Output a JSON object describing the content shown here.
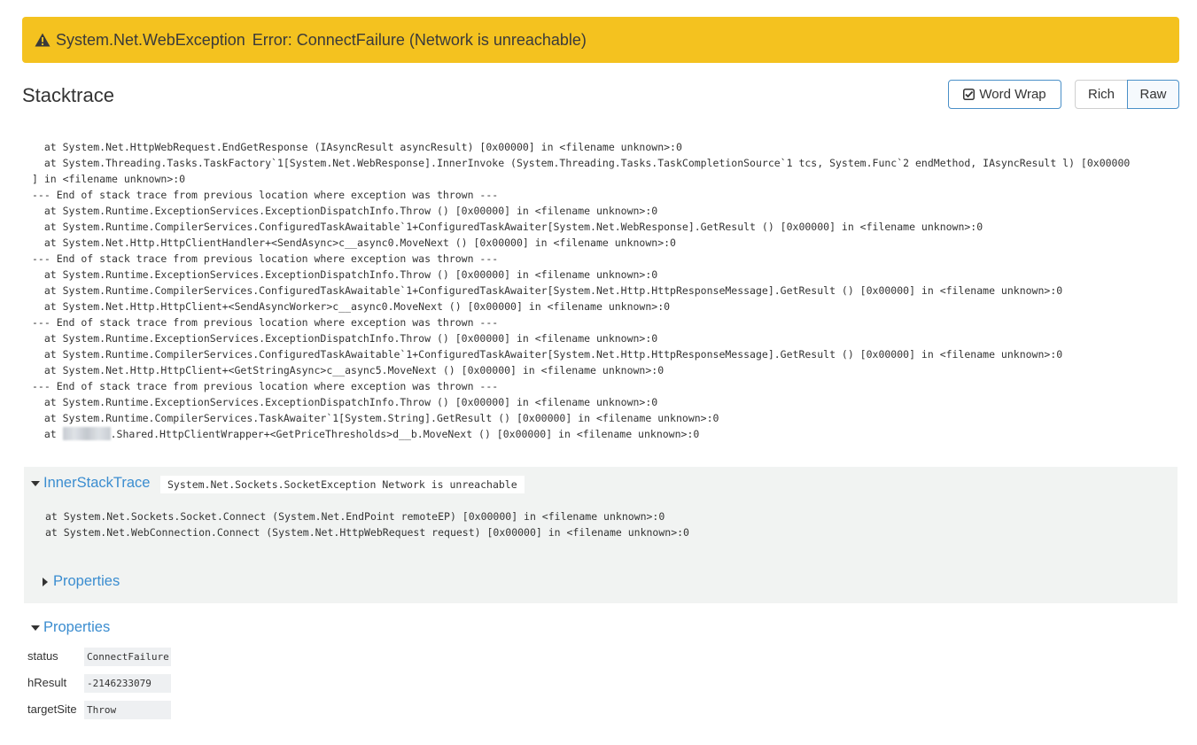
{
  "banner": {
    "exception_type": "System.Net.WebException",
    "message": "Error: ConnectFailure (Network is unreachable)"
  },
  "stacktrace": {
    "title": "Stacktrace",
    "word_wrap_label": "Word Wrap",
    "rich_label": "Rich",
    "raw_label": "Raw",
    "lines": [
      "  at System.Net.HttpWebRequest.EndGetResponse (IAsyncResult asyncResult) [0x00000] in <filename unknown>:0",
      "  at System.Threading.Tasks.TaskFactory`1[System.Net.WebResponse].InnerInvoke (System.Threading.Tasks.TaskCompletionSource`1 tcs, System.Func`2 endMethod, IAsyncResult l) [0x00000",
      "] in <filename unknown>:0",
      "--- End of stack trace from previous location where exception was thrown ---",
      "  at System.Runtime.ExceptionServices.ExceptionDispatchInfo.Throw () [0x00000] in <filename unknown>:0",
      "  at System.Runtime.CompilerServices.ConfiguredTaskAwaitable`1+ConfiguredTaskAwaiter[System.Net.WebResponse].GetResult () [0x00000] in <filename unknown>:0",
      "  at System.Net.Http.HttpClientHandler+<SendAsync>c__async0.MoveNext () [0x00000] in <filename unknown>:0",
      "--- End of stack trace from previous location where exception was thrown ---",
      "  at System.Runtime.ExceptionServices.ExceptionDispatchInfo.Throw () [0x00000] in <filename unknown>:0",
      "  at System.Runtime.CompilerServices.ConfiguredTaskAwaitable`1+ConfiguredTaskAwaiter[System.Net.Http.HttpResponseMessage].GetResult () [0x00000] in <filename unknown>:0",
      "  at System.Net.Http.HttpClient+<SendAsyncWorker>c__async0.MoveNext () [0x00000] in <filename unknown>:0",
      "--- End of stack trace from previous location where exception was thrown ---",
      "  at System.Runtime.ExceptionServices.ExceptionDispatchInfo.Throw () [0x00000] in <filename unknown>:0",
      "  at System.Runtime.CompilerServices.ConfiguredTaskAwaitable`1+ConfiguredTaskAwaiter[System.Net.Http.HttpResponseMessage].GetResult () [0x00000] in <filename unknown>:0",
      "  at System.Net.Http.HttpClient+<GetStringAsync>c__async5.MoveNext () [0x00000] in <filename unknown>:0",
      "--- End of stack trace from previous location where exception was thrown ---",
      "  at System.Runtime.ExceptionServices.ExceptionDispatchInfo.Throw () [0x00000] in <filename unknown>:0",
      "  at System.Runtime.CompilerServices.TaskAwaiter`1[System.String].GetResult () [0x00000] in <filename unknown>:0"
    ],
    "last_line_prefix": "  at ",
    "last_line_suffix": ".Shared.HttpClientWrapper+<GetPriceThresholds>d__b.MoveNext () [0x00000] in <filename unknown>:0"
  },
  "inner": {
    "toggle_label": "InnerStackTrace",
    "message": "System.Net.Sockets.SocketException Network is unreachable",
    "lines": [
      "at System.Net.Sockets.Socket.Connect (System.Net.EndPoint remoteEP) [0x00000] in <filename unknown>:0",
      "at System.Net.WebConnection.Connect (System.Net.HttpWebRequest request) [0x00000] in <filename unknown>:0"
    ],
    "properties_label": "Properties"
  },
  "properties": {
    "toggle_label": "Properties",
    "items": [
      {
        "label": "status",
        "value": "ConnectFailure"
      },
      {
        "label": "hResult",
        "value": "-2146233079"
      },
      {
        "label": "targetSite",
        "value": "Throw"
      }
    ]
  },
  "colors": {
    "banner": "#f4c21f",
    "link": "#3b8dd0",
    "button_border": "#4a90c8",
    "inner_bg": "#f1f3f2"
  },
  "icons": {
    "banner": "warning-icon",
    "word_wrap": "checkbox-checked-icon",
    "expanded": "caret-down-icon",
    "collapsed": "caret-right-icon"
  }
}
